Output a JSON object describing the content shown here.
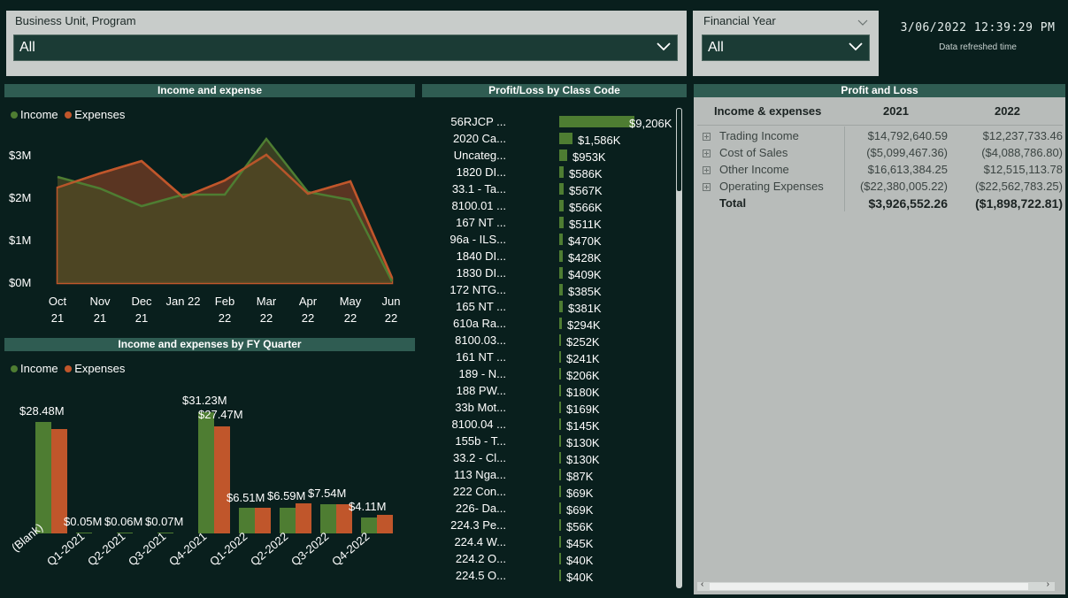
{
  "slicers": {
    "business_unit": {
      "title": "Business Unit, Program",
      "value": "All"
    },
    "financial_year": {
      "title": "Financial Year",
      "value": "All"
    }
  },
  "refresh": {
    "datetime": "3/06/2022 12:39:29 PM",
    "caption": "Data refreshed time"
  },
  "colors": {
    "income": "#4e7d32",
    "expenses": "#c0562b",
    "panel_header": "#2f5c52",
    "background": "#091f1d"
  },
  "income_expense_chart": {
    "header": "Income and expense",
    "legend": [
      "Income",
      "Expenses"
    ],
    "y_ticks": [
      "$3M",
      "$2M",
      "$1M",
      "$0M"
    ],
    "x_ticks": [
      [
        "Oct",
        "21"
      ],
      [
        "Nov",
        "21"
      ],
      [
        "Dec",
        "21"
      ],
      [
        "Jan 22",
        ""
      ],
      [
        "Feb",
        "22"
      ],
      [
        "Mar",
        "22"
      ],
      [
        "Apr",
        "22"
      ],
      [
        "May",
        "22"
      ],
      [
        "Jun",
        "22"
      ]
    ]
  },
  "quarter_chart": {
    "header": "Income and expenses by FY Quarter",
    "legend": [
      "Income",
      "Expenses"
    ],
    "data_labels": [
      "$28.48M",
      "$0.05M",
      "$0.06M",
      "$0.07M",
      "$31.23M",
      "$27.47M",
      "$6.51M",
      "$6.59M",
      "$7.54M",
      "$4.11M"
    ],
    "categories": [
      "(Blank)",
      "Q1-2021",
      "Q2-2021",
      "Q3-2021",
      "Q4-2021",
      "Q1-2022",
      "Q2-2022",
      "Q3-2022",
      "Q4-2022"
    ]
  },
  "profit_loss_class": {
    "header": "Profit/Loss by Class Code",
    "rows": [
      {
        "label": "56RJCP ...",
        "value": "$9,206K"
      },
      {
        "label": "2020 Ca...",
        "value": "$1,586K"
      },
      {
        "label": "Uncateg...",
        "value": "$953K"
      },
      {
        "label": "1820 DI...",
        "value": "$586K"
      },
      {
        "label": "33.1 - Ta...",
        "value": "$567K"
      },
      {
        "label": "8100.01 ...",
        "value": "$566K"
      },
      {
        "label": "167 NT ...",
        "value": "$511K"
      },
      {
        "label": "96a - ILS...",
        "value": "$470K"
      },
      {
        "label": "1840 DI...",
        "value": "$428K"
      },
      {
        "label": "1830 DI...",
        "value": "$409K"
      },
      {
        "label": "172 NTG...",
        "value": "$385K"
      },
      {
        "label": "165 NT ...",
        "value": "$381K"
      },
      {
        "label": "610a Ra...",
        "value": "$294K"
      },
      {
        "label": "8100.03...",
        "value": "$252K"
      },
      {
        "label": "161 NT ...",
        "value": "$241K"
      },
      {
        "label": "189 - N...",
        "value": "$206K"
      },
      {
        "label": "188 PW...",
        "value": "$180K"
      },
      {
        "label": "33b Mot...",
        "value": "$169K"
      },
      {
        "label": "8100.04 ...",
        "value": "$145K"
      },
      {
        "label": "155b - T...",
        "value": "$130K"
      },
      {
        "label": "33.2 - Cl...",
        "value": "$130K"
      },
      {
        "label": "113 Nga...",
        "value": "$87K"
      },
      {
        "label": "222 Con...",
        "value": "$69K"
      },
      {
        "label": "226- Da...",
        "value": "$69K"
      },
      {
        "label": "224.3 Pe...",
        "value": "$56K"
      },
      {
        "label": "224.4 W...",
        "value": "$45K"
      },
      {
        "label": "224.2 O...",
        "value": "$40K"
      },
      {
        "label": "224.5 O...",
        "value": "$40K"
      }
    ]
  },
  "profit_and_loss": {
    "header": "Profit and Loss",
    "columns": [
      "Income & expenses",
      "2021",
      "2022"
    ],
    "rows": [
      {
        "label": "Trading Income",
        "y2021": "$14,792,640.59",
        "y2022": "$12,237,733.46"
      },
      {
        "label": "Cost of Sales",
        "y2021": "($5,099,467.36)",
        "y2022": "($4,088,786.80)"
      },
      {
        "label": "Other Income",
        "y2021": "$16,613,384.25",
        "y2022": "$12,515,113.78"
      },
      {
        "label": "Operating Expenses",
        "y2021": "($22,380,005.22)",
        "y2022": "($22,562,783.25)"
      }
    ],
    "total": {
      "label": "Total",
      "y2021": "$3,926,552.26",
      "y2022": "($1,898,722.81)"
    }
  }
}
